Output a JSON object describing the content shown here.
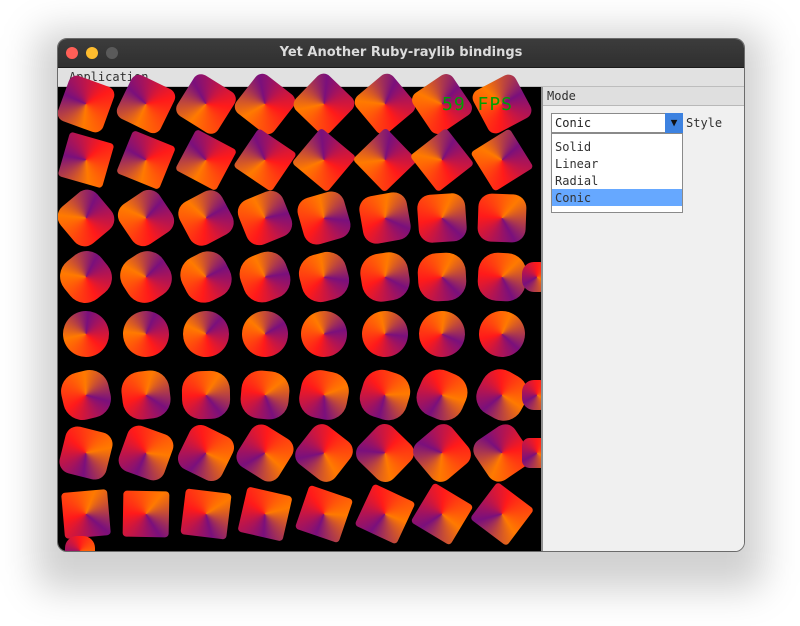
{
  "window": {
    "title": "Yet Another Ruby-raylib bindings"
  },
  "menu": {
    "items": [
      "Application"
    ]
  },
  "viewport": {
    "fps_text": "59 FPS"
  },
  "panel": {
    "header": "Mode",
    "style_combo": {
      "selected": "Conic",
      "label": "Style"
    },
    "dropdown_options": [
      "Solid",
      "Linear",
      "Radial",
      "Conic"
    ],
    "selected_option": "Conic"
  },
  "colors": {
    "fps_text": "#00a000",
    "selection": "#66a8ff",
    "combo_arrow": "#3d82e0",
    "shape_colors": [
      "#ff1a1a",
      "#ff7a00",
      "#7a107c"
    ]
  }
}
